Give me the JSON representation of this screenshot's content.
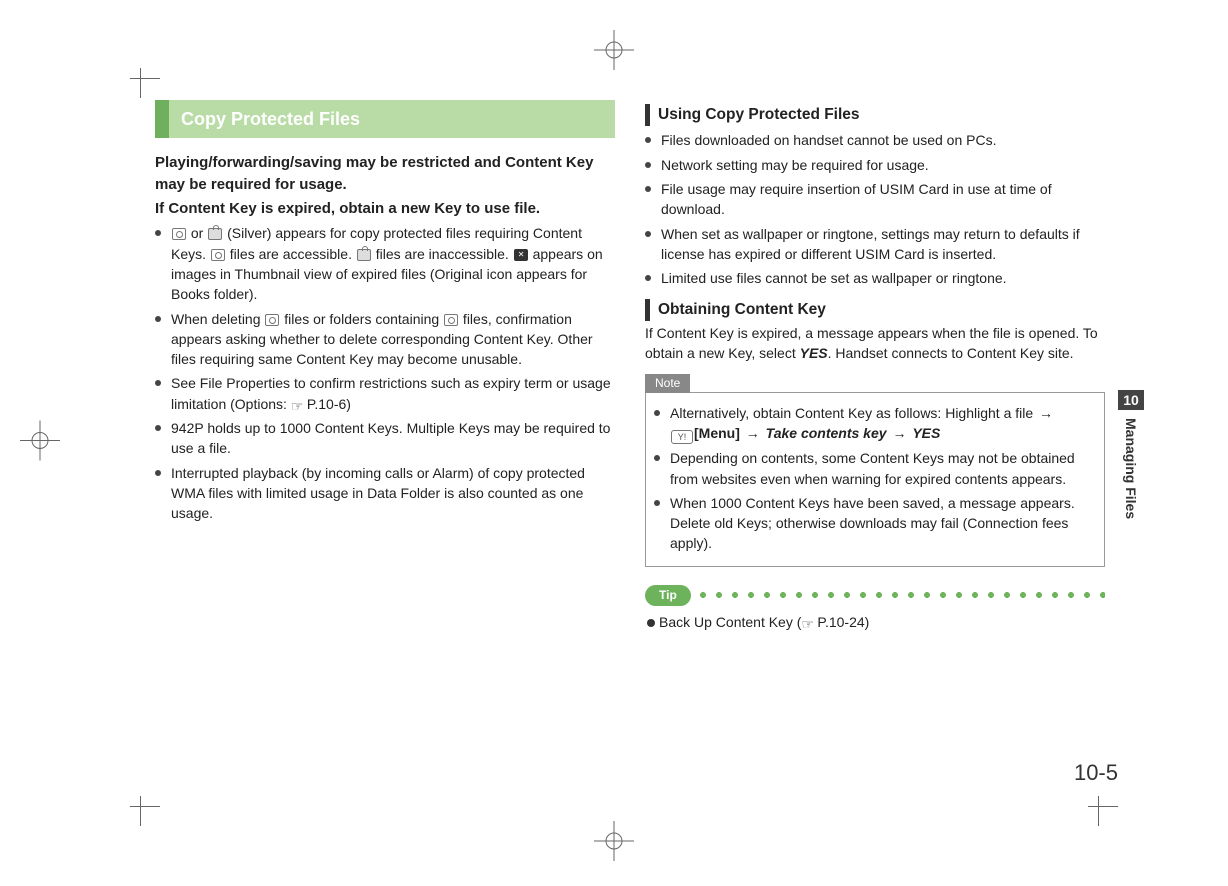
{
  "chapter": {
    "number": "10",
    "title": "Managing Files"
  },
  "page_number": "10-5",
  "left": {
    "section_title": "Copy Protected Files",
    "lead1": "Playing/forwarding/saving may be restricted and Content Key may be required for usage.",
    "lead2": "If Content Key is expired, obtain a new Key to use file.",
    "b1a": " or ",
    "b1b": " (Silver) appears for copy protected files requiring Content Keys. ",
    "b1c": " files are accessible. ",
    "b1d": " files are inaccessible. ",
    "b1e": " appears on images in Thumbnail view of expired files (Original icon appears for Books folder).",
    "b2a": "When deleting ",
    "b2b": " files or folders containing ",
    "b2c": " files, confirmation appears asking whether to delete corresponding Content Key. Other files requiring same Content Key may become unusable.",
    "b3a": "See File Properties to confirm restrictions such as expiry term or usage limitation (Options: ",
    "b3b": "P.10-6)",
    "b4": "942P holds up to 1000 Content Keys. Multiple Keys may be required to use a file.",
    "b5": "Interrupted playback (by incoming calls or Alarm) of copy protected WMA files with limited usage in Data Folder is also counted as one usage."
  },
  "right": {
    "sub1_title": "Using Copy Protected Files",
    "sub1_items": {
      "i1": "Files downloaded on handset cannot be used on PCs.",
      "i2": "Network setting may be required for usage.",
      "i3": "File usage may require insertion of USIM Card in use at time of download.",
      "i4": "When set as wallpaper or ringtone, settings may return to defaults if license has expired or different USIM Card is inserted.",
      "i5": "Limited use files cannot be set as wallpaper or ringtone."
    },
    "sub2_title": "Obtaining Content Key",
    "sub2_body_a": "If Content Key is expired, a message appears when the file is opened. To obtain a new Key, select ",
    "sub2_body_yes": "YES",
    "sub2_body_b": ". Handset connects to Content Key site.",
    "note_label": "Note",
    "note": {
      "n1a": "Alternatively, obtain Content Key as follows: Highlight a file ",
      "n1_menu": "[Menu]",
      "n1_take": "Take contents key",
      "n1_yes": "YES",
      "n2": "Depending on contents, some Content Keys may not be obtained from websites even when warning for expired contents appears.",
      "n3": "When 1000 Content Keys have been saved, a message appears. Delete old Keys; otherwise downloads may fail (Connection fees apply)."
    },
    "tip_label": "Tip",
    "tip_a": "Back Up Content Key (",
    "tip_b": "P.10-24)"
  },
  "icons": {
    "menu_btn": "Y!"
  }
}
